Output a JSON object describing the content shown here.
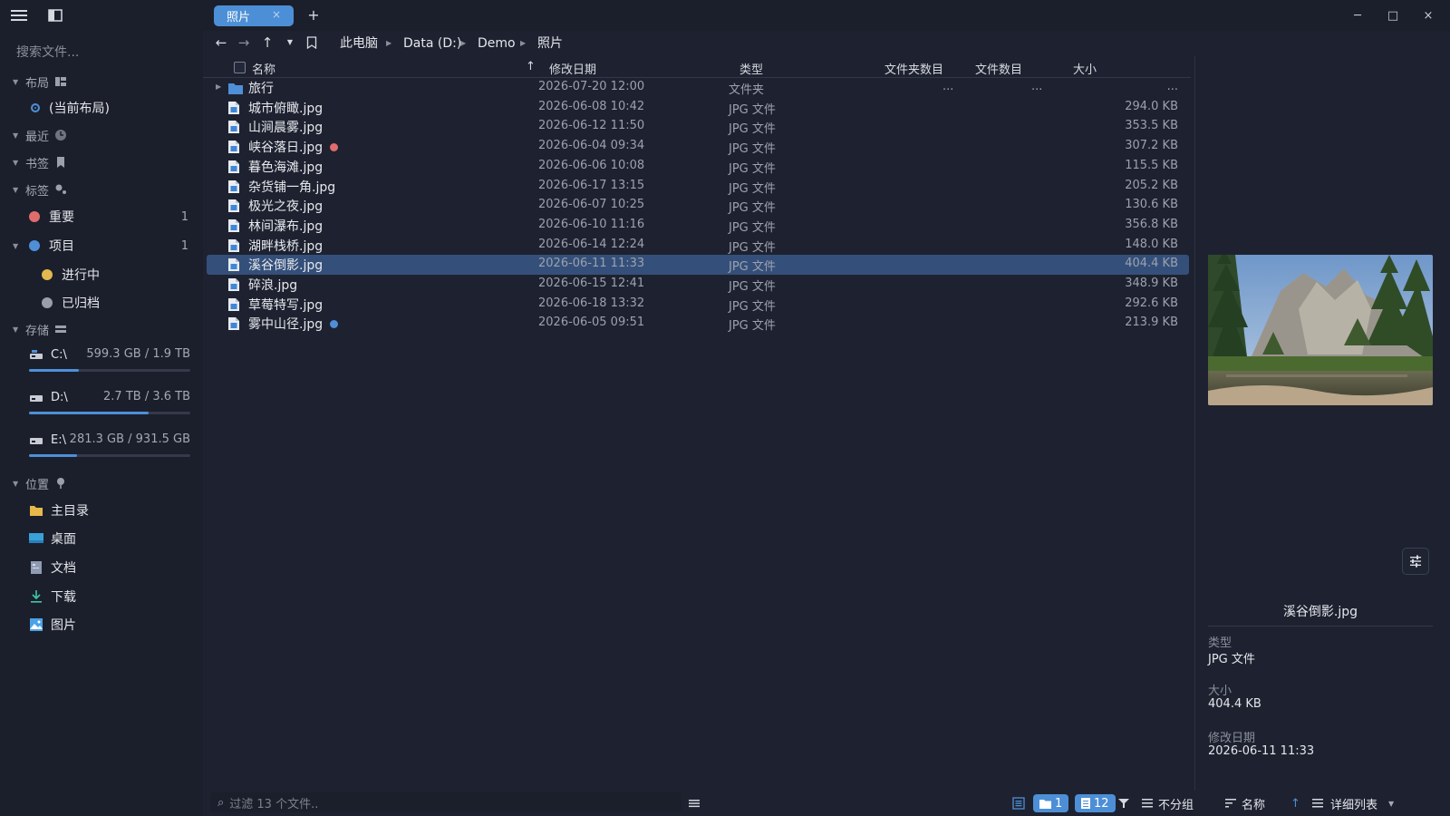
{
  "tabs": [
    {
      "label": "照片",
      "close": "×"
    }
  ],
  "tab_add": "+",
  "window_controls": {
    "minimize": "─",
    "maximize": "□",
    "close": "×"
  },
  "sidebar": {
    "search_placeholder": "搜索文件...",
    "layout": {
      "title": "布局",
      "current": "(当前布局)"
    },
    "recent": {
      "title": "最近"
    },
    "bookmarks": {
      "title": "书签"
    },
    "tags": {
      "title": "标签",
      "items": [
        {
          "label": "重要",
          "count": "1",
          "color": "#e06c6c"
        },
        {
          "label": "项目",
          "count": "1",
          "color": "#4f8fd8"
        },
        {
          "label": "进行中",
          "color": "#e2b84f"
        },
        {
          "label": "已归档",
          "color": "#9a9ea8"
        }
      ]
    },
    "storage": {
      "title": "存储",
      "drives": [
        {
          "name": "C:\\",
          "size": "599.3 GB / 1.9 TB",
          "used_fraction": 0.31
        },
        {
          "name": "D:\\",
          "size": "2.7 TB / 3.6 TB",
          "used_fraction": 0.74
        },
        {
          "name": "E:\\",
          "size": "281.3 GB / 931.5 GB",
          "used_fraction": 0.3
        }
      ]
    },
    "locations": {
      "title": "位置",
      "items": [
        {
          "label": "主目录",
          "icon": "folder-icon"
        },
        {
          "label": "桌面",
          "icon": "desktop-icon"
        },
        {
          "label": "文档",
          "icon": "document-icon"
        },
        {
          "label": "下载",
          "icon": "download-icon"
        },
        {
          "label": "图片",
          "icon": "picture-icon"
        }
      ]
    }
  },
  "breadcrumb": [
    "此电脑",
    "Data (D:)",
    "Demo",
    "照片"
  ],
  "columns": {
    "name": "名称",
    "date": "修改日期",
    "type": "类型",
    "folder_count": "文件夹数目",
    "file_count": "文件数目",
    "size": "大小"
  },
  "files": [
    {
      "name": "旅行",
      "date": "2026-07-20 12:00",
      "type": "文件夹",
      "folder_count": "...",
      "file_count": "...",
      "size": "...",
      "is_folder": true
    },
    {
      "name": "城市俯瞰.jpg",
      "date": "2026-06-08 10:42",
      "type": "JPG 文件",
      "size": "294.0 KB"
    },
    {
      "name": "山涧晨雾.jpg",
      "date": "2026-06-12 11:50",
      "type": "JPG 文件",
      "size": "353.5 KB"
    },
    {
      "name": "峡谷落日.jpg",
      "date": "2026-06-04 09:34",
      "type": "JPG 文件",
      "size": "307.2 KB",
      "tag_color": "#e06c6c"
    },
    {
      "name": "暮色海滩.jpg",
      "date": "2026-06-06 10:08",
      "type": "JPG 文件",
      "size": "115.5 KB"
    },
    {
      "name": "杂货铺一角.jpg",
      "date": "2026-06-17 13:15",
      "type": "JPG 文件",
      "size": "205.2 KB"
    },
    {
      "name": "极光之夜.jpg",
      "date": "2026-06-07 10:25",
      "type": "JPG 文件",
      "size": "130.6 KB"
    },
    {
      "name": "林间瀑布.jpg",
      "date": "2026-06-10 11:16",
      "type": "JPG 文件",
      "size": "356.8 KB"
    },
    {
      "name": "湖畔栈桥.jpg",
      "date": "2026-06-14 12:24",
      "type": "JPG 文件",
      "size": "148.0 KB"
    },
    {
      "name": "溪谷倒影.jpg",
      "date": "2026-06-11 11:33",
      "type": "JPG 文件",
      "size": "404.4 KB",
      "selected": true
    },
    {
      "name": "碎浪.jpg",
      "date": "2026-06-15 12:41",
      "type": "JPG 文件",
      "size": "348.9 KB"
    },
    {
      "name": "草莓特写.jpg",
      "date": "2026-06-18 13:32",
      "type": "JPG 文件",
      "size": "292.6 KB"
    },
    {
      "name": "雾中山径.jpg",
      "date": "2026-06-05 09:51",
      "type": "JPG 文件",
      "size": "213.9 KB",
      "tag_color": "#4f8fd8"
    }
  ],
  "preview": {
    "filename": "溪谷倒影.jpg",
    "props": [
      {
        "label": "类型",
        "value": "JPG 文件"
      },
      {
        "label": "大小",
        "value": "404.4 KB"
      },
      {
        "label": "修改日期",
        "value": "2026-06-11 11:33"
      }
    ]
  },
  "statusbar": {
    "filter_placeholder": "过滤 13 个文件..",
    "folders_count": "1",
    "files_count": "12",
    "group": "不分组",
    "sort": "名称",
    "sort_direction": "↑",
    "view": "详细列表"
  },
  "colors": {
    "accent": "#4d8fd6",
    "selected_row": "#34507a",
    "background": "#1e2230",
    "sidebar": "#1b1f2b"
  }
}
